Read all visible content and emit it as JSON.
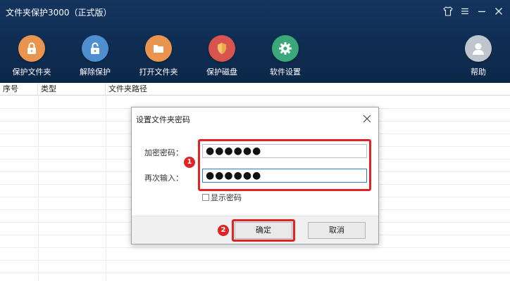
{
  "app": {
    "title": "文件夹保护3000（正式版）",
    "window_controls": [
      "shirt-icon",
      "menu-icon",
      "minimize-icon",
      "close-icon"
    ]
  },
  "toolbar": {
    "items": [
      {
        "label": "保护文件夹",
        "icon": "lock-icon",
        "color": "#e9954f"
      },
      {
        "label": "解除保护",
        "icon": "unlock-icon",
        "color": "#4f8fcf"
      },
      {
        "label": "打开文件夹",
        "icon": "folder-icon",
        "color": "#e9954f"
      },
      {
        "label": "保护磁盘",
        "icon": "shield-icon",
        "color": "#d9534f"
      },
      {
        "label": "软件设置",
        "icon": "gear-icon",
        "color": "#3aa878"
      },
      {
        "label": "帮助",
        "icon": "user-icon",
        "color": "#bfc5cc"
      }
    ]
  },
  "table": {
    "columns": [
      "序号",
      "类型",
      "文件夹路径"
    ],
    "rows": []
  },
  "dialog": {
    "title": "设置文件夹密码",
    "password_label": "加密密码：",
    "password_value": "●●●●●●",
    "confirm_label": "再次输入：",
    "confirm_value": "●●●●●●",
    "show_password_label": "显示密码",
    "ok_label": "确定",
    "cancel_label": "取消",
    "badge_1": "1",
    "badge_2": "2"
  },
  "colors": {
    "header_bg": "#12325a",
    "highlight": "#e02323"
  }
}
